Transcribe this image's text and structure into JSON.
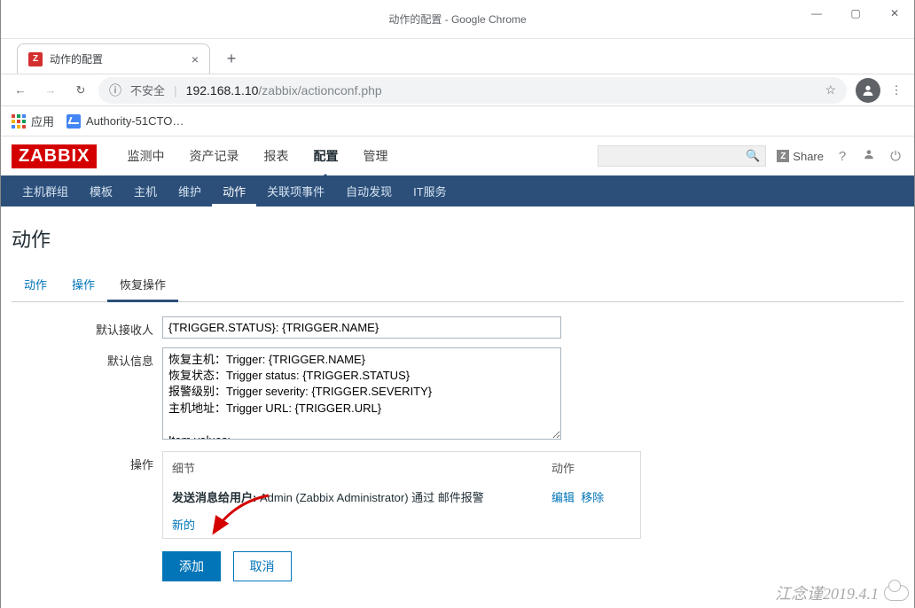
{
  "window": {
    "title": "动作的配置 - Google Chrome",
    "controls": {
      "min": "—",
      "max": "▢",
      "close": "✕"
    }
  },
  "browser": {
    "tab_title": "动作的配置",
    "favicon_letter": "Z",
    "new_tab": "+",
    "tab_close": "×",
    "nav": {
      "back": "←",
      "forward": "→",
      "reload": "↻"
    },
    "omnibox": {
      "info": "ⓘ",
      "insecure": "不安全",
      "sep": "|",
      "host": "192.168.1.10",
      "path": "/zabbix/actionconf.php",
      "star": "☆"
    },
    "avatar": "👤",
    "menu": "⋮",
    "bookmarks": {
      "apps": "应用",
      "item1": "Authority-51CTO…"
    }
  },
  "zabbix": {
    "logo": "ZABBIX",
    "mainnav": [
      "监测中",
      "资产记录",
      "报表",
      "配置",
      "管理"
    ],
    "mainnav_active": 3,
    "share": "Share",
    "share_z": "Z",
    "help": "?",
    "user": "👤",
    "power": "⏻",
    "subnav": [
      "主机群组",
      "模板",
      "主机",
      "维护",
      "动作",
      "关联项事件",
      "自动发现",
      "IT服务"
    ],
    "subnav_active": 4,
    "page_title": "动作",
    "tabs": [
      "动作",
      "操作",
      "恢复操作"
    ],
    "tabs_active": 2,
    "form": {
      "recipient_label": "默认接收人",
      "recipient_value": "{TRIGGER.STATUS}: {TRIGGER.NAME}",
      "message_label": "默认信息",
      "message_value": "恢复主机：Trigger: {TRIGGER.NAME}\n恢复状态：Trigger status: {TRIGGER.STATUS}\n报警级别：Trigger severity: {TRIGGER.SEVERITY}\n主机地址：Trigger URL: {TRIGGER.URL}\n\nItem values:",
      "ops_label": "操作",
      "ops": {
        "col_detail": "细节",
        "col_action": "动作",
        "row_prefix": "发送消息给用户:",
        "row_text": " Admin (Zabbix Administrator) 通过 邮件报警",
        "edit": "编辑",
        "remove": "移除",
        "new": "新的"
      },
      "buttons": {
        "add": "添加",
        "cancel": "取消"
      }
    }
  },
  "watermark": "江念谨2019.4.1"
}
